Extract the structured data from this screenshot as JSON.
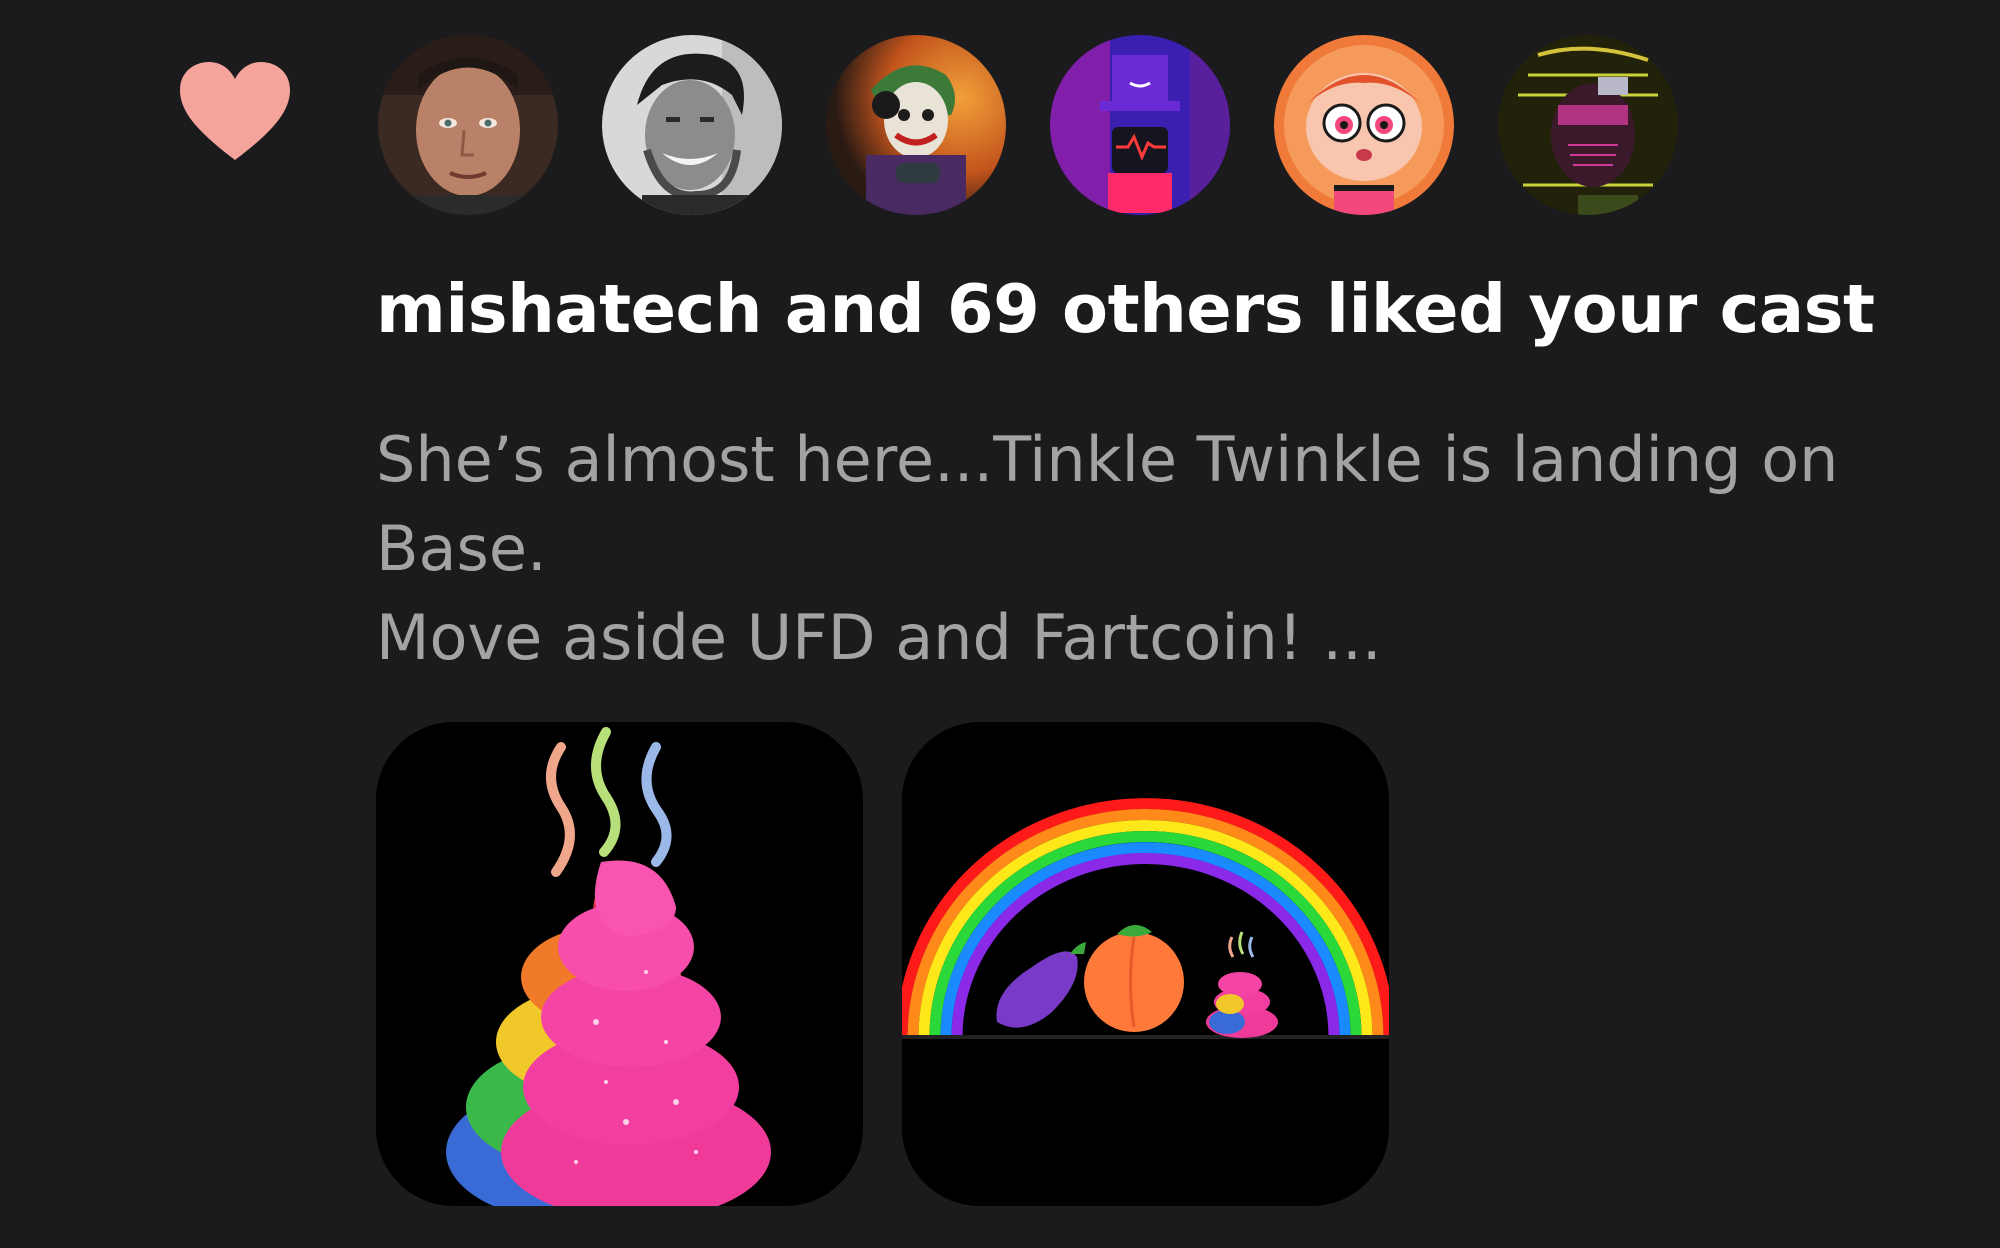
{
  "notification": {
    "type_icon": "heart-icon",
    "icon_color": "#f5a49b",
    "title": "mishatech and 69 others liked your cast",
    "cast_preview": {
      "lines": [
        "She’s almost here...Tinkle Twinkle is landing on",
        "Base.",
        "Move aside UFD and Fartcoin! ..."
      ]
    },
    "avatars": [
      {
        "name": "avatar-1",
        "description": "man portrait"
      },
      {
        "name": "avatar-2",
        "description": "smiling man black and white"
      },
      {
        "name": "avatar-3",
        "description": "joker gamer"
      },
      {
        "name": "avatar-4",
        "description": "purple robot with top hat"
      },
      {
        "name": "avatar-5",
        "description": "cartoon girl"
      },
      {
        "name": "avatar-6",
        "description": "neon glitch portrait"
      }
    ],
    "attachments": [
      {
        "name": "rainbow-poop-image"
      },
      {
        "name": "rainbow-emoji-image"
      }
    ]
  },
  "colors": {
    "background": "#1b1b1d",
    "title": "#ffffff",
    "body": "#a3a3a5",
    "heart": "#f5a49b"
  }
}
